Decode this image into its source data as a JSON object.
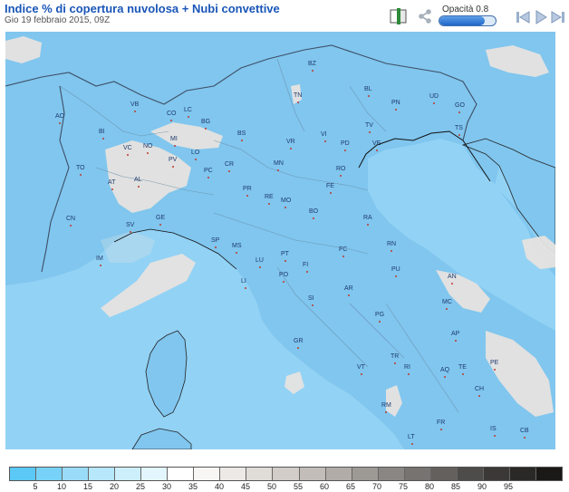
{
  "header": {
    "title": "Indice % di copertura nuvolosa + Nubi convettive",
    "subtitle": "Gio 19 febbraio 2015, 09Z"
  },
  "toolbar": {
    "opacity_label": "Opacità 0.8",
    "opacity_value": 0.8,
    "icons": [
      "book-icon",
      "share-icon",
      "prev-icon",
      "play-icon",
      "next-icon"
    ]
  },
  "map": {
    "cities": [
      {
        "label": "AO"
      },
      {
        "label": "BI"
      },
      {
        "label": "VB"
      },
      {
        "label": "CO"
      },
      {
        "label": "LC"
      },
      {
        "label": "BG"
      },
      {
        "label": "BS"
      },
      {
        "label": "MI"
      },
      {
        "label": "VC"
      },
      {
        "label": "NO"
      },
      {
        "label": "LO"
      },
      {
        "label": "TO"
      },
      {
        "label": "AT"
      },
      {
        "label": "AL"
      },
      {
        "label": "PV"
      },
      {
        "label": "PC"
      },
      {
        "label": "CR"
      },
      {
        "label": "CN"
      },
      {
        "label": "SV"
      },
      {
        "label": "GE"
      },
      {
        "label": "IM"
      },
      {
        "label": "SP"
      },
      {
        "label": "MS"
      },
      {
        "label": "LU"
      },
      {
        "label": "PT"
      },
      {
        "label": "FI"
      },
      {
        "label": "PO"
      },
      {
        "label": "LI"
      },
      {
        "label": "SI"
      },
      {
        "label": "GR"
      },
      {
        "label": "AR"
      },
      {
        "label": "PG"
      },
      {
        "label": "TR"
      },
      {
        "label": "VT"
      },
      {
        "label": "RI"
      },
      {
        "label": "RM"
      },
      {
        "label": "LT"
      },
      {
        "label": "FR"
      },
      {
        "label": "IS"
      },
      {
        "label": "CB"
      },
      {
        "label": "CH"
      },
      {
        "label": "AQ"
      },
      {
        "label": "TE"
      },
      {
        "label": "PE"
      },
      {
        "label": "AP"
      },
      {
        "label": "MC"
      },
      {
        "label": "AN"
      },
      {
        "label": "PU"
      },
      {
        "label": "RN"
      },
      {
        "label": "FC"
      },
      {
        "label": "RA"
      },
      {
        "label": "BO"
      },
      {
        "label": "FE"
      },
      {
        "label": "MO"
      },
      {
        "label": "RE"
      },
      {
        "label": "PR"
      },
      {
        "label": "MN"
      },
      {
        "label": "VR"
      },
      {
        "label": "VI"
      },
      {
        "label": "PD"
      },
      {
        "label": "RO"
      },
      {
        "label": "TV"
      },
      {
        "label": "VE"
      },
      {
        "label": "BL"
      },
      {
        "label": "PN"
      },
      {
        "label": "UD"
      },
      {
        "label": "GO"
      },
      {
        "label": "TS"
      },
      {
        "label": "TN"
      },
      {
        "label": "BZ"
      }
    ]
  },
  "legend": {
    "colors": [
      "#5bc8f5",
      "#78d2f7",
      "#9adcf8",
      "#b6e7fa",
      "#cdeffb",
      "#e3f6fd",
      "#ffffff",
      "#f7f6f4",
      "#ece9e6",
      "#e0dcd8",
      "#d2cdc9",
      "#c2bdb9",
      "#b1aca8",
      "#9d9995",
      "#8a8683",
      "#767370",
      "#63605d",
      "#4e4c4a",
      "#3b3938",
      "#2a2928",
      "#1a1918"
    ],
    "labels": [
      "5",
      "10",
      "15",
      "20",
      "25",
      "30",
      "35",
      "40",
      "45",
      "50",
      "55",
      "60",
      "65",
      "70",
      "75",
      "80",
      "85",
      "90",
      "95"
    ]
  }
}
